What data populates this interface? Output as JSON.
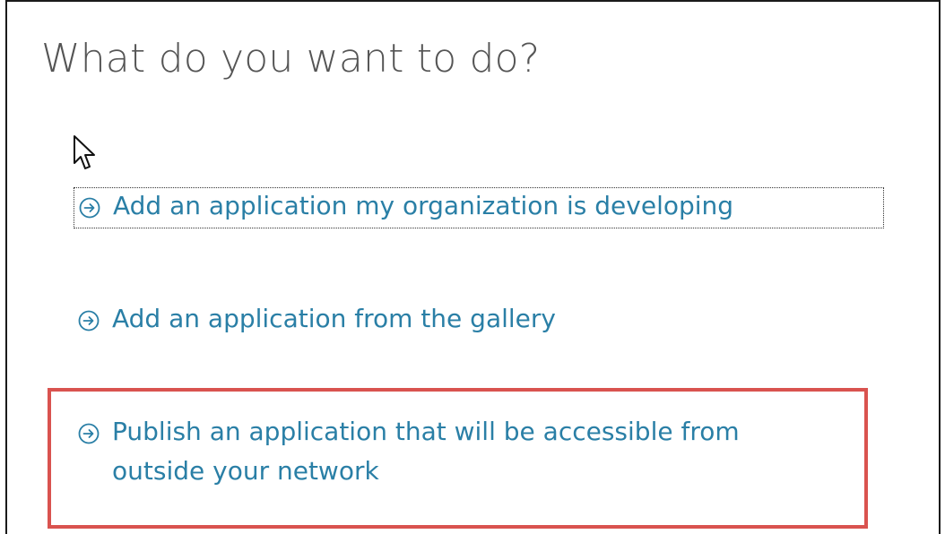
{
  "dialog": {
    "title": "What do you want to do?"
  },
  "options": [
    {
      "label": "Add an application my organization is developing",
      "icon": "arrow-right-circle-icon",
      "focused": true
    },
    {
      "label": "Add an application from the gallery",
      "icon": "arrow-right-circle-icon",
      "focused": false
    },
    {
      "label": "Publish an application that will be accessible from outside your network",
      "icon": "arrow-right-circle-icon",
      "focused": false,
      "highlighted": true
    }
  ],
  "colors": {
    "link": "#2a7fa6",
    "title": "#555555",
    "highlight_box": "#d9534f"
  }
}
